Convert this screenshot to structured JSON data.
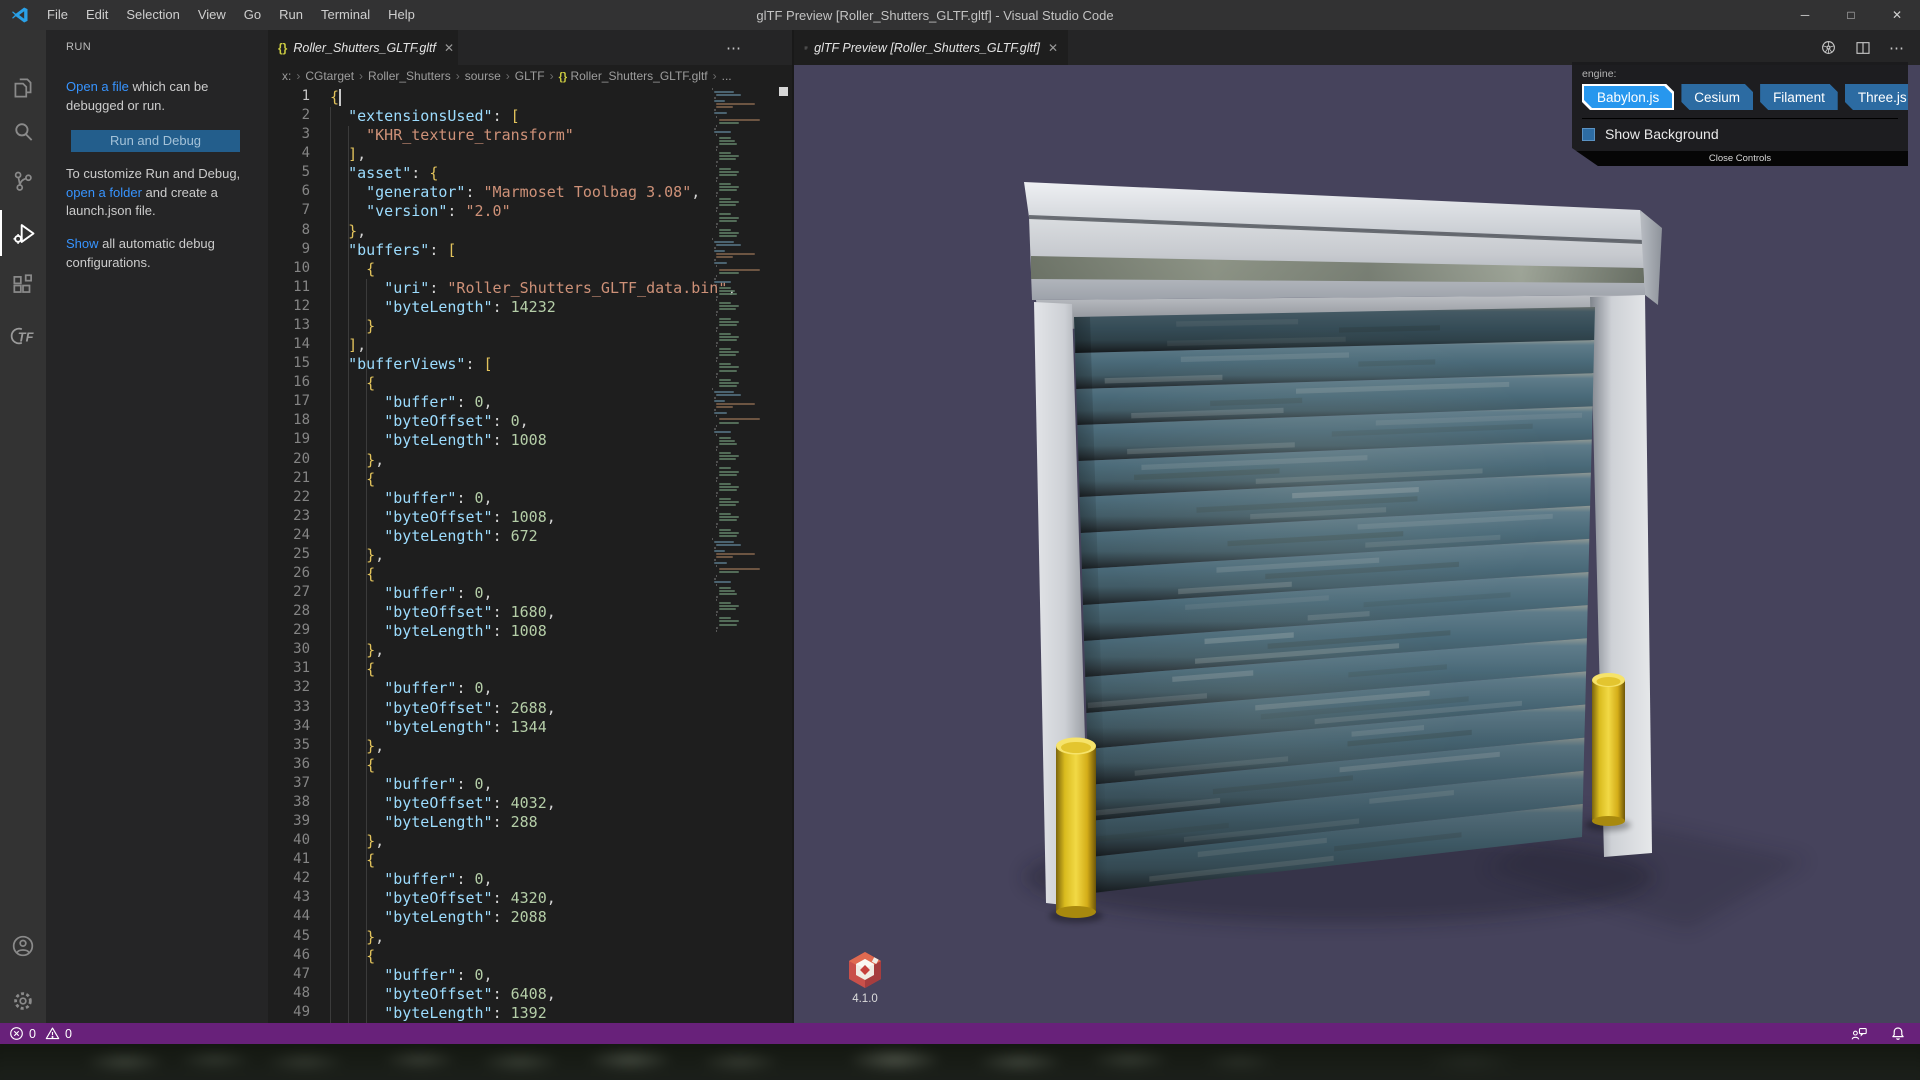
{
  "window": {
    "title": "glTF Preview [Roller_Shutters_GLTF.gltf] - Visual Studio Code",
    "menu": [
      "File",
      "Edit",
      "Selection",
      "View",
      "Go",
      "Run",
      "Terminal",
      "Help"
    ],
    "controls": {
      "minimize": "─",
      "maximize": "□",
      "close": "✕"
    }
  },
  "activity_bar": {
    "icons": [
      "explorer",
      "search",
      "source-control",
      "run-and-debug",
      "extensions",
      "gltf-tools",
      "account",
      "settings"
    ],
    "active": "run-and-debug"
  },
  "sidebar": {
    "header": "RUN",
    "p1_link": "Open a file",
    "p1_rest": " which can be debugged or run.",
    "button_label": "Run and Debug",
    "p2_pre": "To customize Run and Debug, ",
    "p2_link": "open a folder",
    "p2_post": " and create a launch.json file.",
    "p3_link": "Show",
    "p3_rest": " all automatic debug configurations."
  },
  "editor": {
    "tab_label": "Roller_Shutters_GLTF.gltf",
    "braces_icon": "{}",
    "close_icon": "✕",
    "more_icon": "⋯",
    "breadcrumb_separator": "›",
    "breadcrumbs": [
      "x:",
      "CGtarget",
      "Roller_Shutters",
      "sourse",
      "GLTF",
      "Roller_Shutters_GLTF.gltf",
      "..."
    ],
    "code_lines": [
      "{",
      "  \"extensionsUsed\": [",
      "    \"KHR_texture_transform\"",
      "  ],",
      "  \"asset\": {",
      "    \"generator\": \"Marmoset Toolbag 3.08\",",
      "    \"version\": \"2.0\"",
      "  },",
      "  \"buffers\": [",
      "    {",
      "      \"uri\": \"Roller_Shutters_GLTF_data.bin\",",
      "      \"byteLength\": 14232",
      "    }",
      "  ],",
      "  \"bufferViews\": [",
      "    {",
      "      \"buffer\": 0,",
      "      \"byteOffset\": 0,",
      "      \"byteLength\": 1008",
      "    },",
      "    {",
      "      \"buffer\": 0,",
      "      \"byteOffset\": 1008,",
      "      \"byteLength\": 672",
      "    },",
      "    {",
      "      \"buffer\": 0,",
      "      \"byteOffset\": 1680,",
      "      \"byteLength\": 1008",
      "    },",
      "    {",
      "      \"buffer\": 0,",
      "      \"byteOffset\": 2688,",
      "      \"byteLength\": 1344",
      "    },",
      "    {",
      "      \"buffer\": 0,",
      "      \"byteOffset\": 4032,",
      "      \"byteLength\": 288",
      "    },",
      "    {",
      "      \"buffer\": 0,",
      "      \"byteOffset\": 4320,",
      "      \"byteLength\": 2088",
      "    },",
      "    {",
      "      \"buffer\": 0,",
      "      \"byteOffset\": 6408,",
      "      \"byteLength\": 1392"
    ]
  },
  "preview": {
    "tab_label": "glTF Preview [Roller_Shutters_GLTF.gltf]",
    "engine_label": "engine:",
    "engines": [
      "Babylon.js",
      "Cesium",
      "Filament",
      "Three.js"
    ],
    "selected_engine": "Babylon.js",
    "show_background_label": "Show Background",
    "close_controls_label": "Close Controls",
    "babylon_version": "4.1.0"
  },
  "status_bar": {
    "errors": "0",
    "warnings": "0"
  },
  "colors": {
    "status_bar": "#68217a",
    "accent_link": "#3794ff",
    "engine_selected": "#2797ee",
    "engine_button": "#2c6ba2",
    "viewport_background": "#46435c",
    "bollard_yellow": "#e8c824"
  }
}
